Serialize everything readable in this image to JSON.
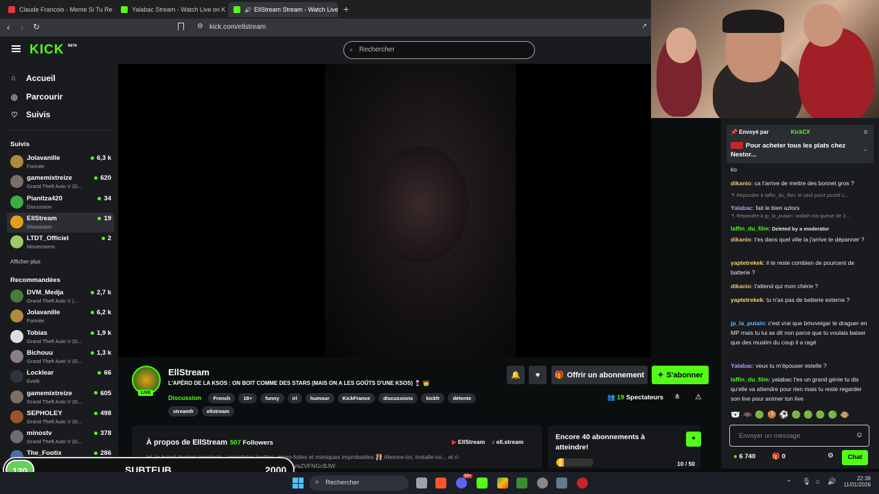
{
  "browser": {
    "tabs": [
      {
        "title": "Claude Francois - Meme Si Tu Revena",
        "color": "#e53935"
      },
      {
        "title": "Yalabac Stream - Watch Live on Kick",
        "color": "#53fc18"
      },
      {
        "title": "EllStream Stream - Watch Live",
        "color": "#53fc18"
      }
    ],
    "url": "kick.com/ellstream"
  },
  "header": {
    "logo": "KICK",
    "beta": "BETA",
    "search_placeholder": "Rechercher"
  },
  "nav": [
    {
      "label": "Accueil",
      "icon": "home-icon"
    },
    {
      "label": "Parcourir",
      "icon": "compass-icon"
    },
    {
      "label": "Suivis",
      "icon": "heart-icon"
    }
  ],
  "followed_title": "Suivis",
  "followed": [
    {
      "name": "Jolavanille",
      "game": "Fortnite",
      "viewers": "6,3 k",
      "color": "#b08a3a"
    },
    {
      "name": "gamemixtreize",
      "game": "Grand Theft Auto V (G...",
      "viewers": "620",
      "color": "#7c6f66"
    },
    {
      "name": "Pianitza420",
      "game": "Discussion",
      "viewers": "34",
      "color": "#3cb043"
    },
    {
      "name": "EllStream",
      "game": "Discussion",
      "viewers": "19",
      "color": "#e6a017"
    },
    {
      "name": "LTDT_Officiel",
      "game": "Movierooms",
      "viewers": "2",
      "color": "#9ccc65"
    }
  ],
  "show_more": "Afficher plus",
  "recommended_title": "Recommandées",
  "recommended": [
    {
      "name": "DVM_Medja",
      "game": "Grand Theft Auto V (...",
      "viewers": "2,7 k",
      "color": "#4b7b3a"
    },
    {
      "name": "Jolavanille",
      "game": "Fortnite",
      "viewers": "6,2 k",
      "color": "#b08a3a"
    },
    {
      "name": "Tobias",
      "game": "Grand Theft Auto V (G...",
      "viewers": "1,9 k",
      "color": "#dddddd"
    },
    {
      "name": "Bichouu",
      "game": "Grand Theft Auto V (G...",
      "viewers": "1,3 k",
      "color": "#8a7d88"
    },
    {
      "name": "Locklear",
      "game": "Evolit",
      "viewers": "66",
      "color": "#2e3440"
    },
    {
      "name": "gamemixtreize",
      "game": "Grand Theft Auto V (G...",
      "viewers": "605",
      "color": "#7c6f66"
    },
    {
      "name": "SEPHOLEY",
      "game": "Grand Theft Auto V (G...",
      "viewers": "498",
      "color": "#a0522d"
    },
    {
      "name": "minostv",
      "game": "Grand Theft Auto V (G...",
      "viewers": "378",
      "color": "#6d6d6d"
    },
    {
      "name": "The_Footix",
      "game": "Grand Theft Auto V (G...",
      "viewers": "286",
      "color": "#4a6fa5"
    }
  ],
  "stream": {
    "name": "EllStream",
    "live": "LIVE",
    "title": "L'APÉRO DE LA KSOS : ON BOIT COMME DES STARS (MAIS ON A LES GOÛTS D'UNE KSOS) 🍷 👑",
    "category": "Discussion",
    "tags": [
      "French",
      "18+",
      "funny",
      "irl",
      "humour",
      "KickFrance",
      "discussions",
      "kickfr",
      "détente",
      "streamfr",
      "ellstream"
    ],
    "gift_label": "Offrir un abonnement",
    "subscribe_label": "S'abonner",
    "viewers_count": "19",
    "viewers_label": "Spectateurs"
  },
  "about": {
    "title": "À propos de EllStream",
    "followers_count": "507",
    "followers_label": "Followers",
    "youtube": "EllStream",
    "tiktok": "ell.stream",
    "bio1": "Ici, le banal devient spectacle : anecdotes inutiles, micro-folies et mimiques improbables 🩰 Abonne-toi, installe-toi... et ri-",
    "bio2": "ensemble de tout (et surtout de rien) 😄 https://discord.gg/aZVFNGcBJW"
  },
  "goal": {
    "title": "Encore 40 abonnements à atteindre!",
    "current": 10,
    "target": 50,
    "progress_text": "10 / 50"
  },
  "chat": {
    "pinned_sender_label": "Envoyé par",
    "pinned_sender": "KickCX",
    "pinned_text": "Pour acheter tous les plats chez Nestor...",
    "messages": [
      {
        "user": "",
        "text": "ko",
        "color": "#e8e8e8"
      },
      {
        "user": "dikanio",
        "text": "ca t'arrive de mettre des bonnet gros ?",
        "color": "#f4c27a"
      },
      {
        "user": "Yalabac",
        "text": "fait le bien azlors",
        "color": "#b99cff",
        "reply": "Répondre à laffin_du_film: le seul point positif c..."
      },
      {
        "user": "laffin_du_film",
        "text": "Deleted by a moderator",
        "color": "#53fc18",
        "reply": "Répondre à jp_la_putain: wallah ma queue de 2..."
      },
      {
        "user": "dikanio",
        "text": "t'es dans quel ville la j'arrive te dépanner ?",
        "color": "#f4c27a"
      },
      {
        "user": "yaptetrekek",
        "text": "il te reste combien de pourcent de batterie ?",
        "color": "#ffd166"
      },
      {
        "user": "dikanio",
        "text": "t'attend qui mon chérie ?",
        "color": "#f4c27a"
      },
      {
        "user": "yaptetrekek",
        "text": "tu n'as pas de batterie externe ?",
        "color": "#ffd166"
      },
      {
        "user": "jp_la_putain",
        "text": "c'est vrai que bmvveigar te draguer en MP mais tu lui as dit non parce que tu voulais baiser que des muslim du coup il a ragé",
        "color": "#5fb8ff"
      },
      {
        "user": "Yalabac",
        "text": "veux tu m'épouser estelle ?",
        "color": "#b99cff"
      },
      {
        "user": "laffin_du_film",
        "text": "yalabac t'es un grand génie tu dis qu'elle va attendre pour rien mais tu reste regarder son live pour animer ton live",
        "color": "#53fc18"
      }
    ],
    "input_placeholder": "Envoyer un message",
    "points": "6 740",
    "gifts": "0",
    "send_label": "Chat"
  },
  "overlay": {
    "left_number": "120",
    "label": "SUBTEUB",
    "right_number": "2000"
  },
  "taskbar": {
    "search_placeholder": "Rechercher",
    "time": "22:38",
    "date": "11/01/2026",
    "discord_badge": "99+"
  }
}
